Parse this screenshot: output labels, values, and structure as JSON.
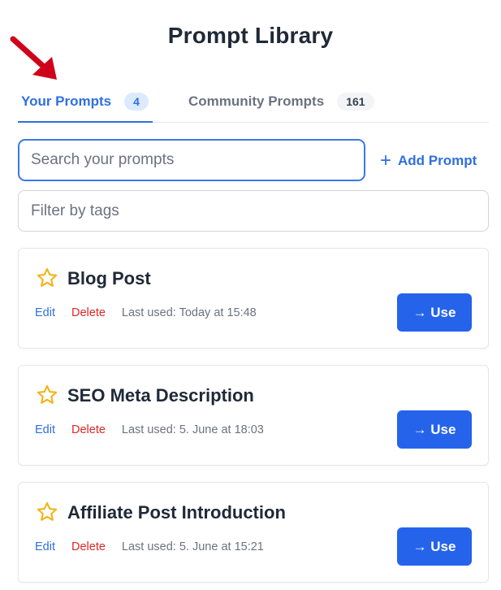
{
  "header": {
    "title": "Prompt Library"
  },
  "colors": {
    "accent": "#2f6fe0",
    "primary_button": "#2563eb",
    "danger": "#dc2626",
    "star": "#f2b418",
    "annotation_arrow": "#d0021b"
  },
  "tabs": [
    {
      "label": "Your Prompts",
      "count": "4",
      "active": true
    },
    {
      "label": "Community Prompts",
      "count": "161",
      "active": false
    }
  ],
  "search": {
    "placeholder": "Search your prompts",
    "value": ""
  },
  "add_button": {
    "icon": "plus-icon",
    "label": "Add Prompt"
  },
  "filter": {
    "placeholder": "Filter by tags",
    "value": ""
  },
  "prompts": [
    {
      "title": "Blog Post",
      "edit_label": "Edit",
      "delete_label": "Delete",
      "last_used": "Last used: Today at 15:48",
      "use_label": "→ Use",
      "star_icon": "star-outline-icon"
    },
    {
      "title": "SEO Meta Description",
      "edit_label": "Edit",
      "delete_label": "Delete",
      "last_used": "Last used: 5. June at 18:03",
      "use_label": "→ Use",
      "star_icon": "star-outline-icon"
    },
    {
      "title": "Affiliate Post Introduction",
      "edit_label": "Edit",
      "delete_label": "Delete",
      "last_used": "Last used: 5. June at 15:21",
      "use_label": "→ Use",
      "star_icon": "star-outline-icon"
    }
  ]
}
